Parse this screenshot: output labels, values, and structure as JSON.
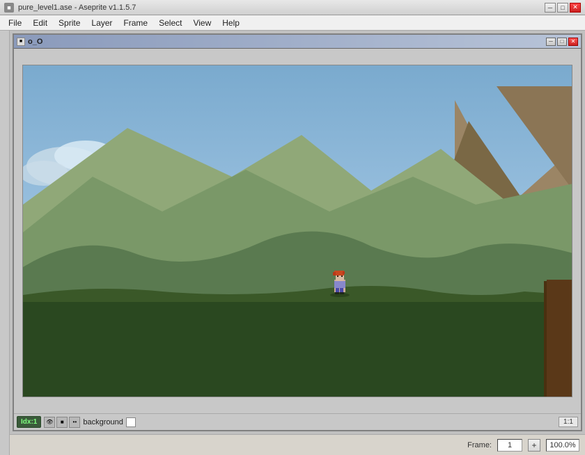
{
  "app": {
    "title": "pure_level1.ase - Aseprite v1.1.5.7",
    "os_icon": "■"
  },
  "os_controls": {
    "minimize": "─",
    "maximize": "□",
    "close": "✕"
  },
  "menubar": {
    "items": [
      "File",
      "Edit",
      "Sprite",
      "Layer",
      "Frame",
      "Select",
      "View",
      "Help"
    ]
  },
  "inner_window": {
    "title": "o_O",
    "controls": {
      "minimize": "─",
      "maximize": "□",
      "close": "✕"
    }
  },
  "statusbar": {
    "idx_label": "Idx:1",
    "layer_name": "background",
    "frame_label": "Frame:",
    "frame_value": "1",
    "frame_plus": "+",
    "zoom_value": "100.0%"
  },
  "colors": {
    "sky_top": "#8eb0d8",
    "sky_bottom": "#aac4e0",
    "far_mountain_brown": "#8b7355",
    "mountain_dark_brown": "#6b5340",
    "hill_light_green": "#8fa878",
    "hill_mid_green": "#6a8560",
    "hill_dark_green": "#4a6844",
    "ground_dark": "#2d4a20",
    "ground_very_dark": "#1e3518",
    "cloud_white": "#d8e8f0",
    "cliff_brown": "#5a3820"
  },
  "icons": {
    "eye_icon": "👁",
    "lock_icon": "🔒",
    "link_icon": "••"
  }
}
